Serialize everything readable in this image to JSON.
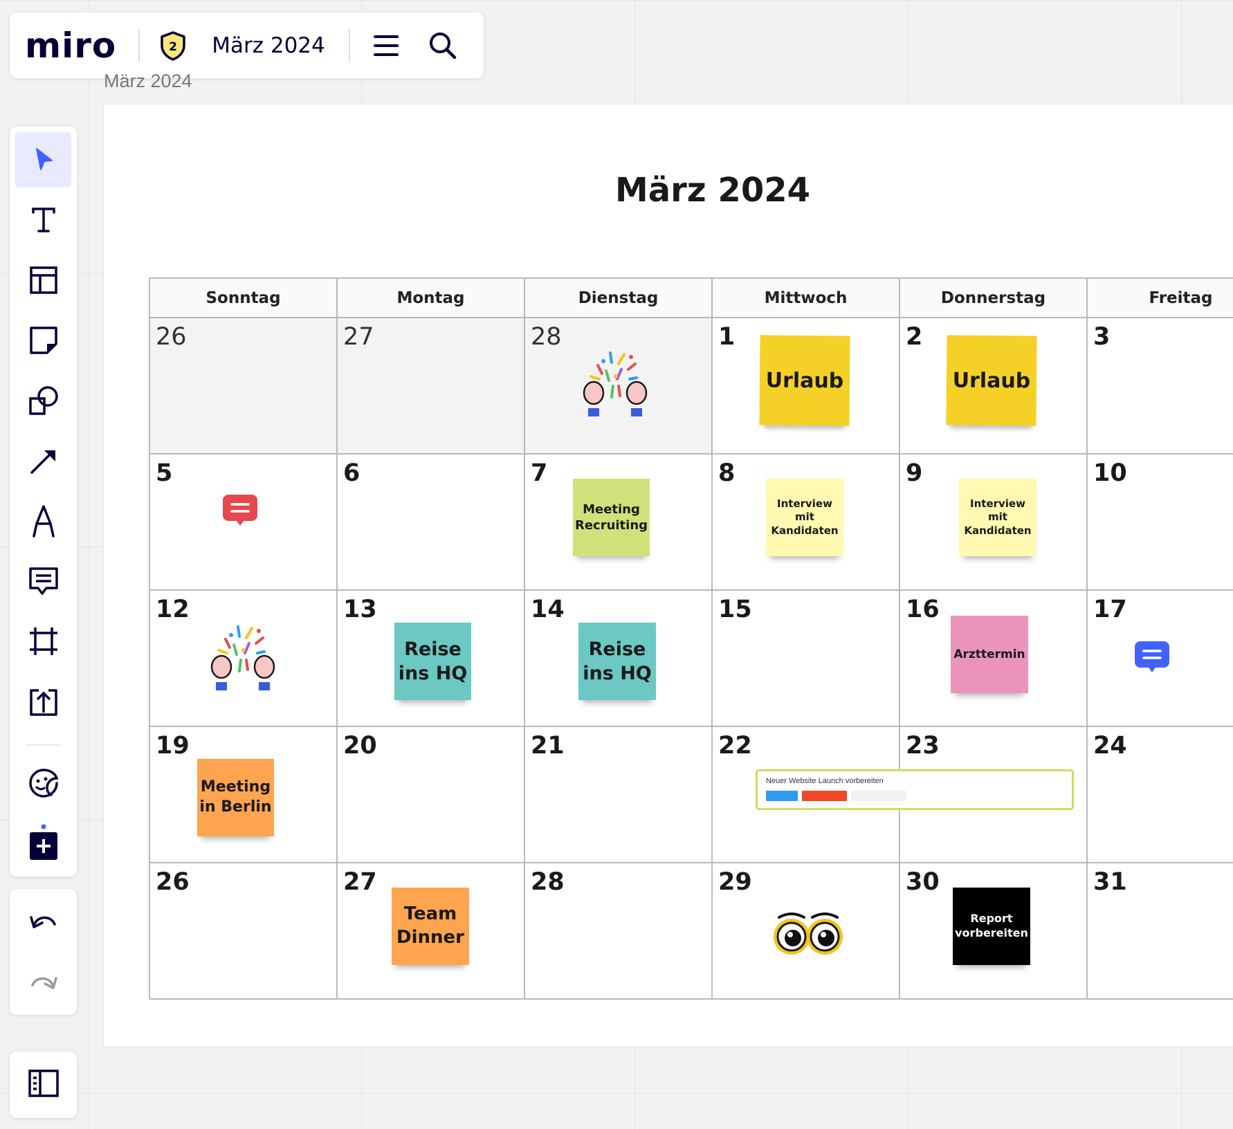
{
  "app": {
    "logo": "miro",
    "board_title": "März 2024",
    "badge": "2"
  },
  "frame": {
    "label": "März 2024",
    "title": "März 2024"
  },
  "calendar": {
    "weekdays": [
      "Sonntag",
      "Montag",
      "Dienstag",
      "Mittwoch",
      "Donnerstag",
      "Freitag"
    ],
    "weeks": [
      [
        "26",
        "27",
        "28",
        "1",
        "2",
        "3"
      ],
      [
        "5",
        "6",
        "7",
        "8",
        "9",
        "10"
      ],
      [
        "12",
        "13",
        "14",
        "15",
        "16",
        "17"
      ],
      [
        "19",
        "20",
        "21",
        "22",
        "23",
        "24"
      ],
      [
        "26",
        "27",
        "28",
        "29",
        "30",
        "31"
      ]
    ]
  },
  "stickies": {
    "urlaub_1": "Urlaub",
    "urlaub_2": "Urlaub",
    "meeting_recruiting": [
      "Meeting",
      "Recruiting"
    ],
    "interview_1": [
      "Interview",
      "mit",
      "Kandidaten"
    ],
    "interview_2": [
      "Interview",
      "mit",
      "Kandidaten"
    ],
    "reise_1": [
      "Reise",
      "ins HQ"
    ],
    "reise_2": [
      "Reise",
      "ins HQ"
    ],
    "arzttermin": "Arzttermin",
    "meeting_berlin": [
      "Meeting",
      "in Berlin"
    ],
    "team_dinner": [
      "Team",
      "Dinner"
    ],
    "report": [
      "Report",
      "vorbereiten"
    ]
  },
  "project_card": {
    "title": "Neuer Website Launch vorbereiten"
  },
  "colors": {
    "yellow": "#f5d128",
    "light_yellow": "#fff9b1",
    "lime": "#d0e17a",
    "teal": "#6cc8c3",
    "pink": "#ea94bb",
    "orange": "#ffa44f",
    "black": "#000000",
    "accent": "#4262ff",
    "comment_red": "#e5484d",
    "comment_blue": "#4262ff"
  },
  "toolbar": {
    "tools": [
      "select-cursor-icon",
      "text-icon",
      "templates-icon",
      "sticky-note-icon",
      "shapes-icon",
      "arrow-line-icon",
      "pen-icon",
      "comment-icon",
      "frame-icon",
      "upload-icon",
      "stickers-icon",
      "add-apps-icon"
    ],
    "history": [
      "undo-icon",
      "redo-icon"
    ],
    "bottom": [
      "panel-toggle-icon"
    ]
  }
}
